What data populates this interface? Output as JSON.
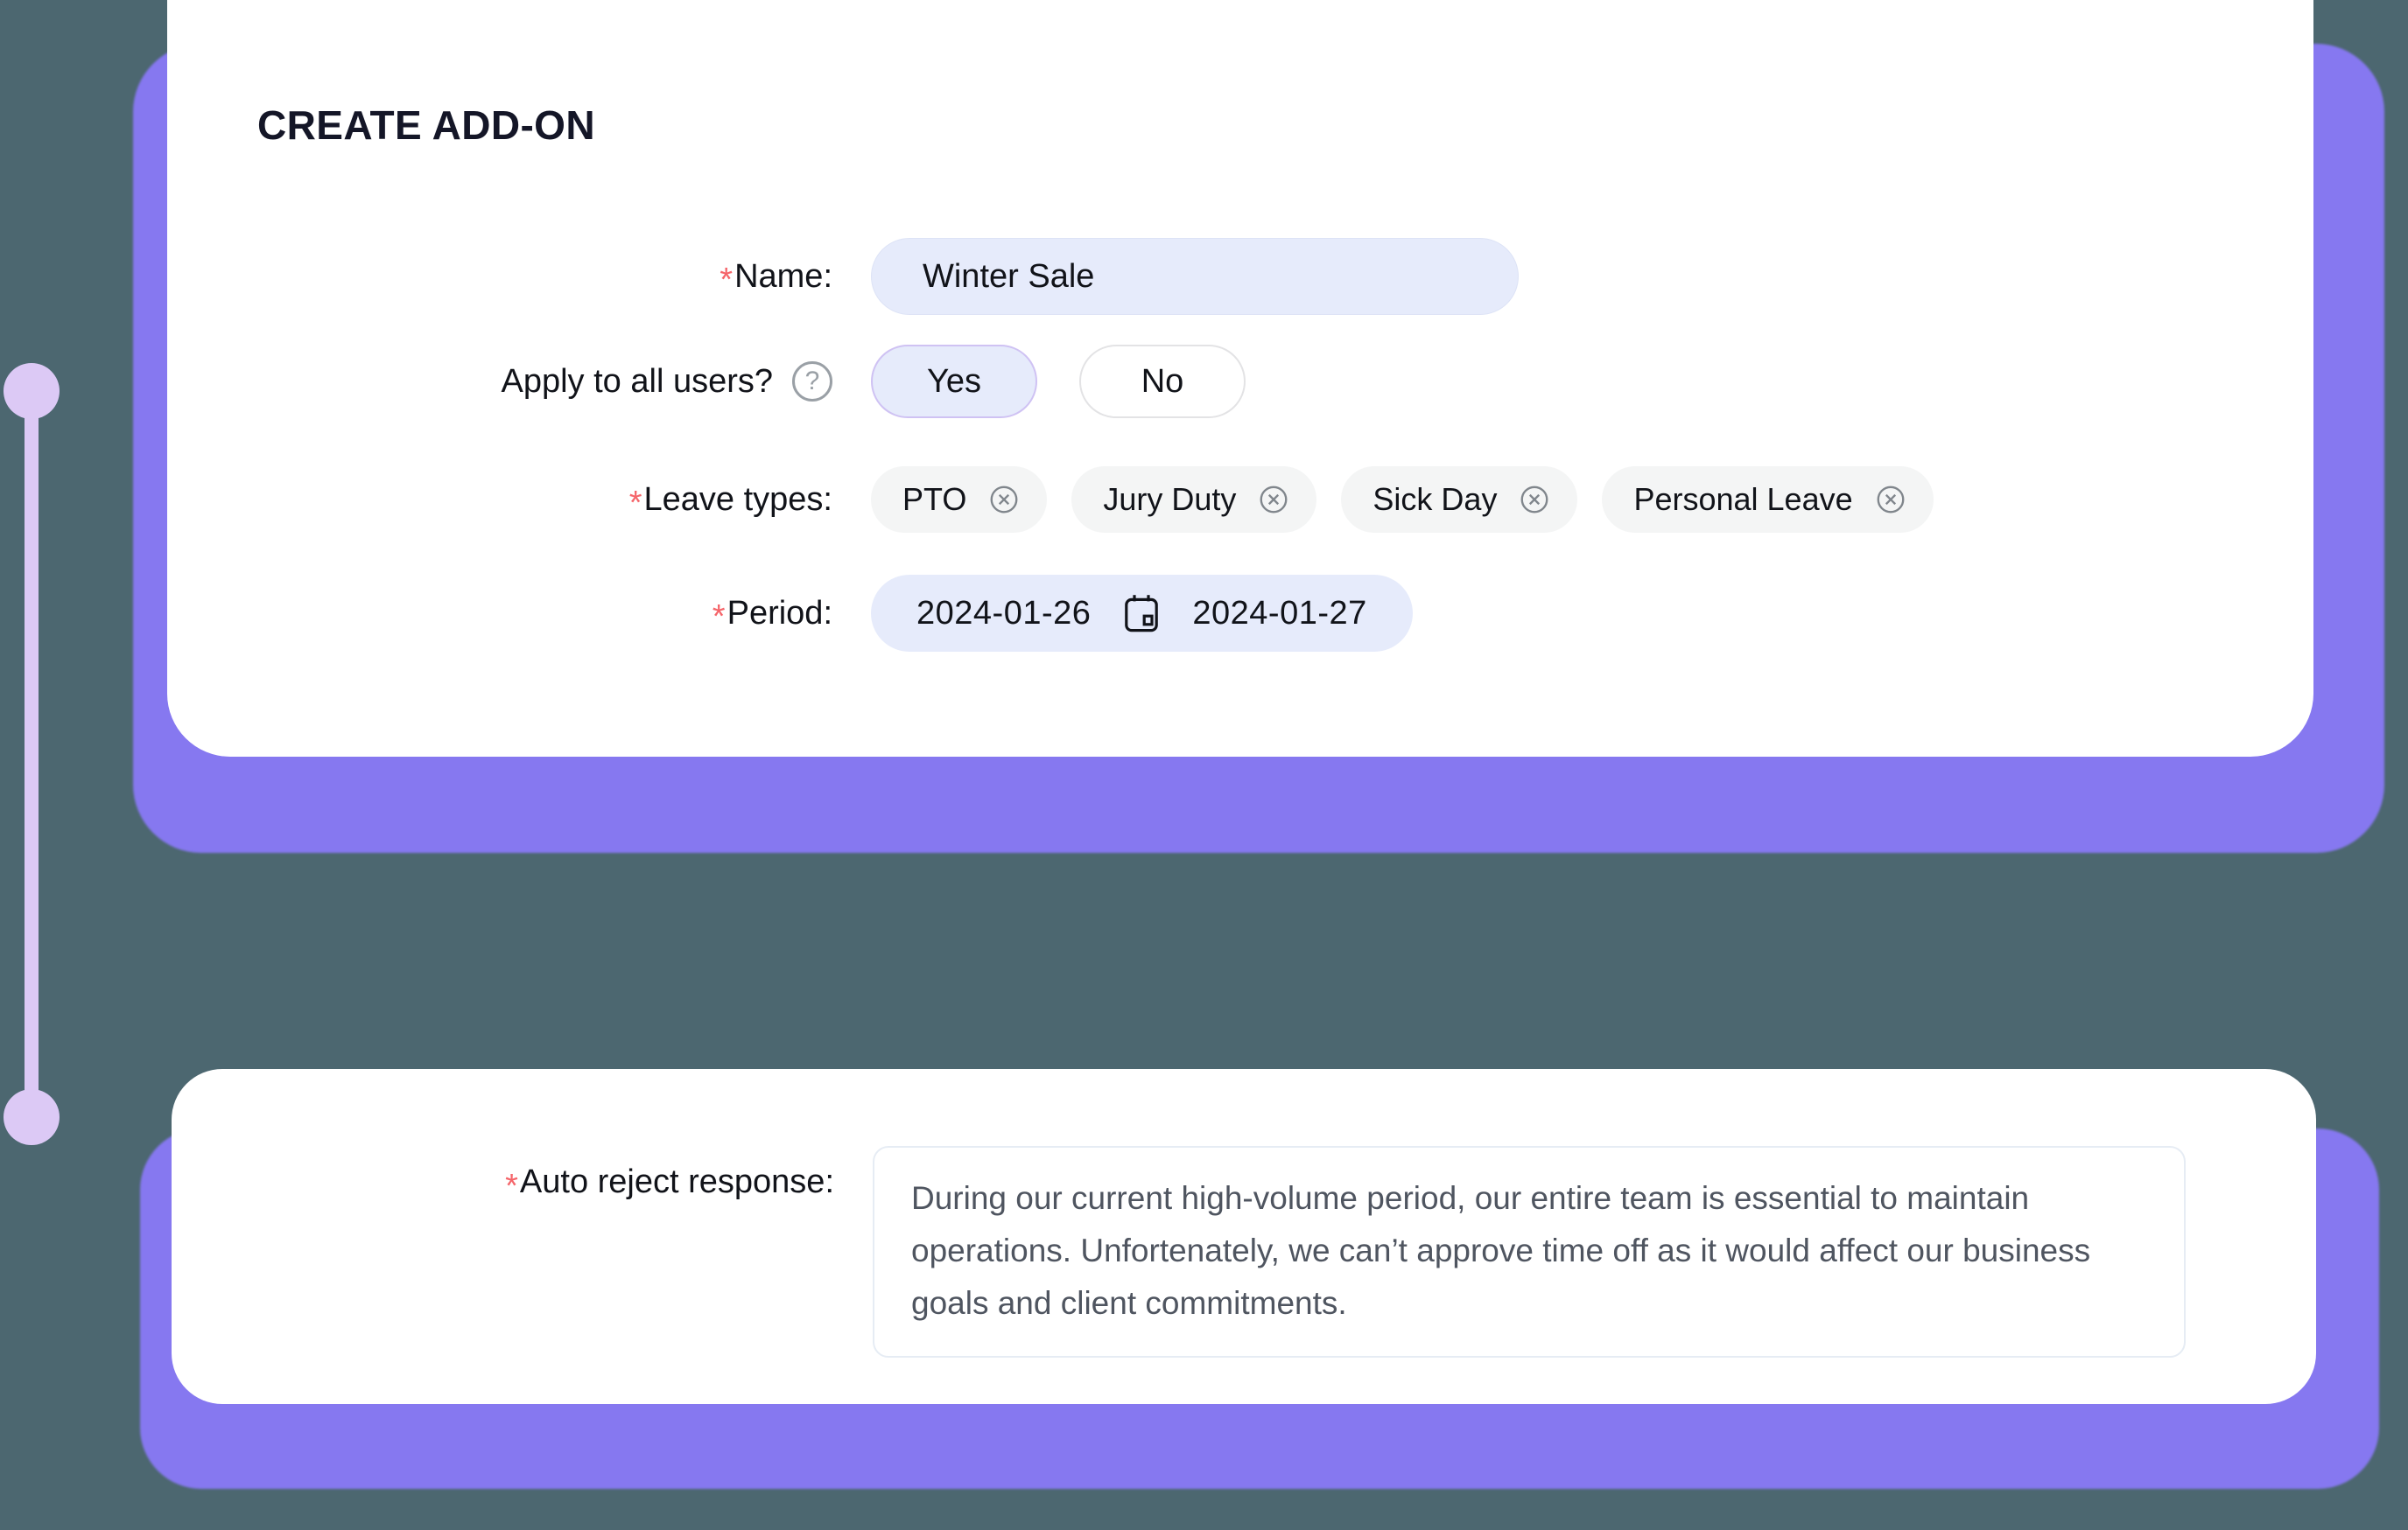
{
  "theme": {
    "page_background": "#4c6770",
    "card_shadow_purple": "#8678f0",
    "timeline_lavender": "#dcc9f5",
    "input_fill": "#e6ebfb",
    "required_star": "#f5656a",
    "tag_fill": "#f4f5f5",
    "selected_border": "#cfc2f3",
    "title_color": "#141627",
    "textarea_text": "#4f5560"
  },
  "create_addon_card": {
    "title": "CREATE ADD-ON",
    "name_row": {
      "required_marker": "*",
      "label": "Name:",
      "value": "Winter Sale",
      "placeholder": "Winter Sale"
    },
    "apply_all_row": {
      "label": "Apply to all users?",
      "help_icon": "help-circle-icon",
      "options": [
        {
          "label": "Yes",
          "selected": true
        },
        {
          "label": "No",
          "selected": false
        }
      ]
    },
    "leave_types_row": {
      "required_marker": "*",
      "label": "Leave types:",
      "tags": [
        {
          "label": "PTO",
          "remove_icon": "close-circle-icon"
        },
        {
          "label": "Jury Duty",
          "remove_icon": "close-circle-icon"
        },
        {
          "label": "Sick Day",
          "remove_icon": "close-circle-icon"
        },
        {
          "label": "Personal Leave",
          "remove_icon": "close-circle-icon"
        }
      ]
    },
    "period_row": {
      "required_marker": "*",
      "label": "Period:",
      "start_date": "2024-01-26",
      "end_date": "2024-01-27",
      "separator_icon": "calendar-icon"
    }
  },
  "auto_reject_card": {
    "required_marker": "*",
    "label": "Auto reject response:",
    "value": "During our current high-volume period, our entire team is essential to maintain operations. Unfortenately, we can’t approve time off as it would affect our business goals and client commitments."
  },
  "timeline": {
    "dots": [
      {
        "name": "step-dot-one"
      },
      {
        "name": "step-dot-two"
      }
    ]
  }
}
